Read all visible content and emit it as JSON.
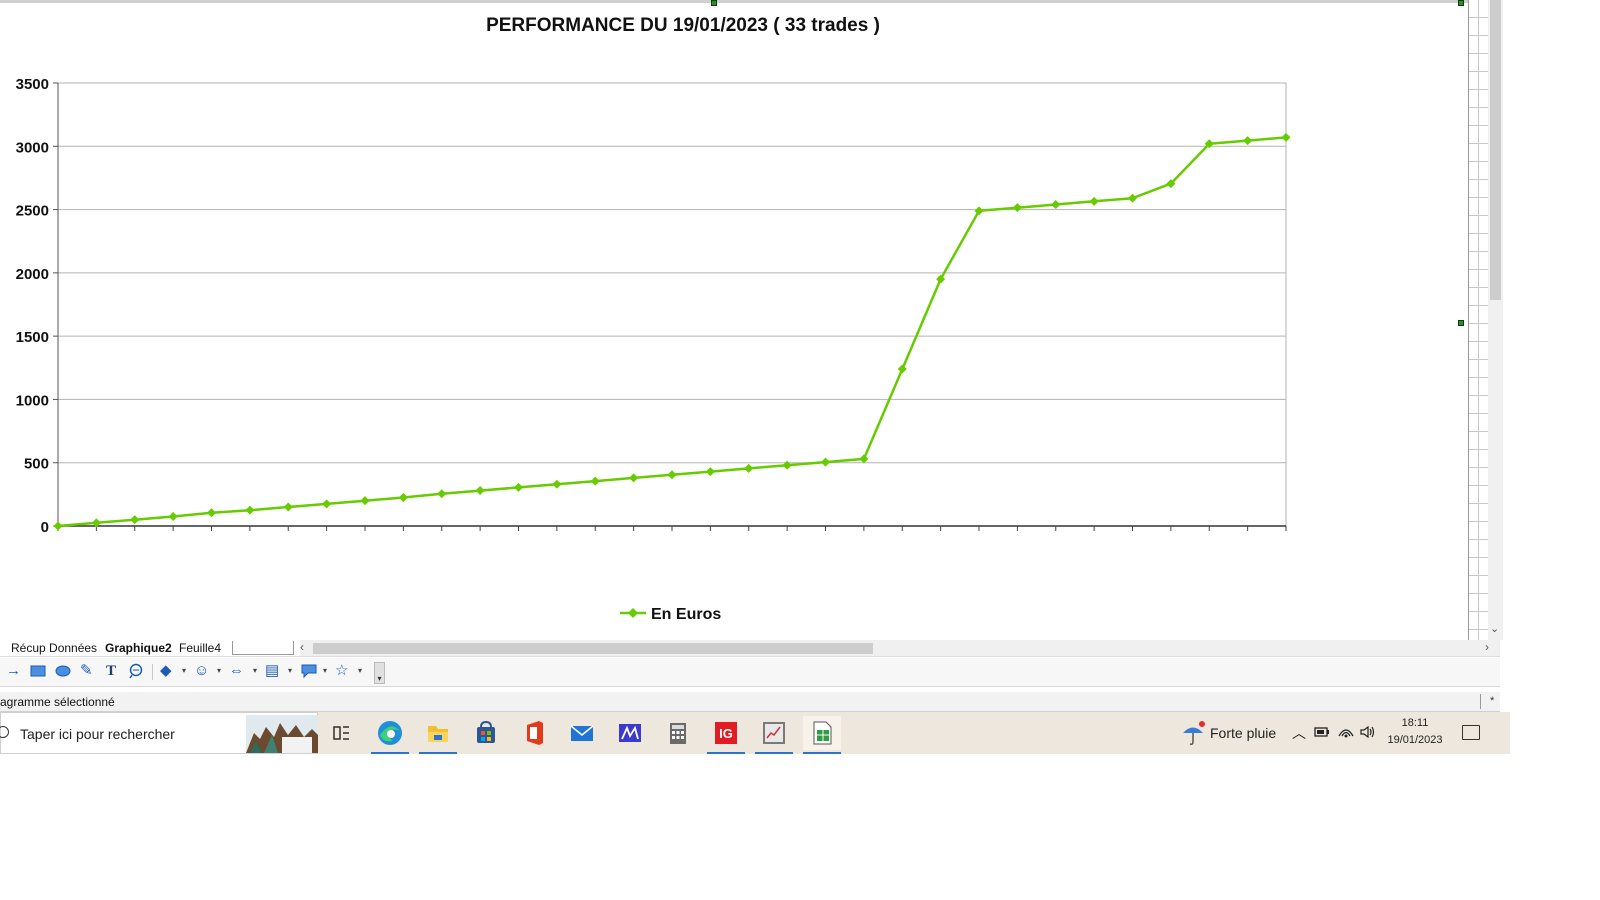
{
  "chart_data": {
    "type": "line",
    "title": "PERFORMANCE DU 19/01/2023 ( 33 trades )",
    "xlabel": "",
    "ylabel": "",
    "ylim": [
      0,
      3500
    ],
    "y_ticks": [
      "0",
      "500",
      "1000",
      "1500",
      "2000",
      "2500",
      "3000",
      "3500"
    ],
    "x": [
      1,
      2,
      3,
      4,
      5,
      6,
      7,
      8,
      9,
      10,
      11,
      12,
      13,
      14,
      15,
      16,
      17,
      18,
      19,
      20,
      21,
      22,
      23,
      24,
      25,
      26,
      27,
      28,
      29,
      30,
      31,
      32,
      33
    ],
    "series": [
      {
        "name": "En Euros",
        "color": "#66cc00",
        "values": [
          0,
          25,
          50,
          75,
          105,
          125,
          150,
          175,
          200,
          225,
          255,
          280,
          305,
          330,
          355,
          380,
          405,
          430,
          455,
          480,
          505,
          530,
          1240,
          1950,
          2490,
          2515,
          2540,
          2565,
          2590,
          2705,
          3020,
          3045,
          3070
        ]
      }
    ],
    "grid": true,
    "legend": "bottom"
  },
  "sheet_tabs": [
    {
      "label": "Récup Données",
      "active": false
    },
    {
      "label": "Graphique2",
      "active": true
    },
    {
      "label": "Feuille4",
      "active": false
    }
  ],
  "status": {
    "text": "agramme sélectionné",
    "star": "*"
  },
  "taskbar": {
    "search_placeholder": "Taper ici pour rechercher",
    "weather": "Forte pluie",
    "time": "18:11",
    "date": "19/01/2023",
    "apps": [
      "task-view-icon",
      "edge-icon",
      "file-explorer-icon",
      "store-icon",
      "office-icon",
      "mail-icon",
      "app-icon",
      "calculator-icon",
      "ig-icon",
      "chart-app-icon",
      "calc-spreadsheet-icon"
    ],
    "ig_label": "IG"
  },
  "colors": {
    "series": "#66cc00",
    "taskbar": "#eee7de",
    "accent": "#2a72d4"
  }
}
